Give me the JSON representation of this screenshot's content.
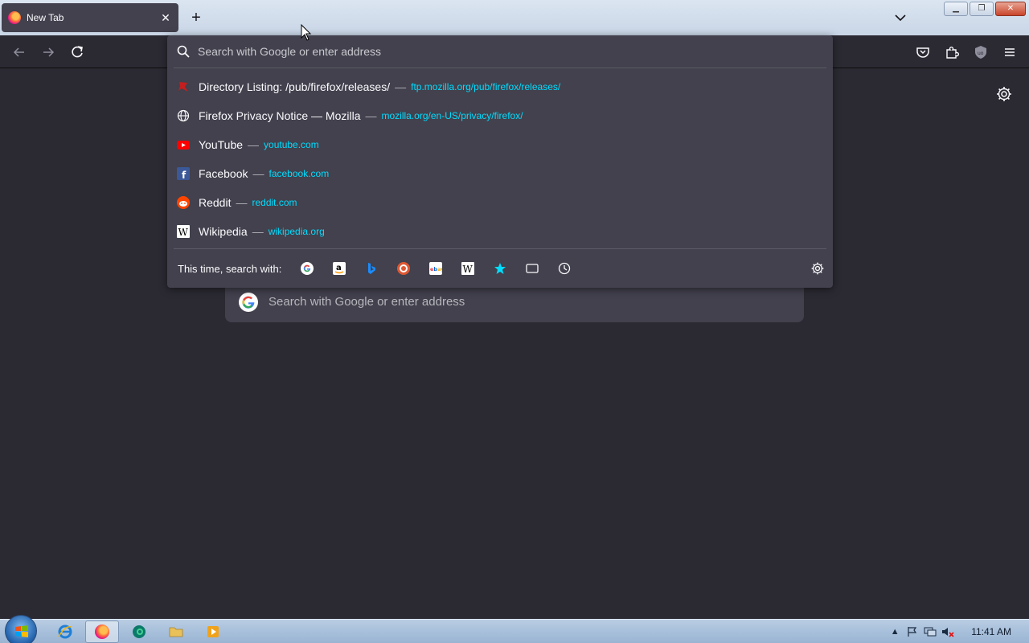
{
  "tab": {
    "title": "New Tab",
    "close": "✕"
  },
  "newtab": {
    "label": "+"
  },
  "urlbar": {
    "placeholder": "Search with Google or enter address",
    "results": [
      {
        "title": "Directory Listing: /pub/firefox/releases/",
        "url": "ftp.mozilla.org/pub/firefox/releases/",
        "icon": "ftp-bug-icon"
      },
      {
        "title": "Firefox Privacy Notice — Mozilla",
        "url": "mozilla.org/en-US/privacy/firefox/",
        "icon": "globe-icon"
      },
      {
        "title": "YouTube",
        "url": "youtube.com",
        "icon": "youtube-icon"
      },
      {
        "title": "Facebook",
        "url": "facebook.com",
        "icon": "facebook-icon"
      },
      {
        "title": "Reddit",
        "url": "reddit.com",
        "icon": "reddit-icon"
      },
      {
        "title": "Wikipedia",
        "url": "wikipedia.org",
        "icon": "wikipedia-icon"
      }
    ],
    "separator": "—",
    "oneoffs_label": "This time, search with:"
  },
  "content": {
    "search_placeholder": "Search with Google or enter address"
  },
  "taskbar": {
    "clock": "11:41 AM"
  },
  "colors": {
    "accent_url": "#00ddff",
    "panel": "#42414d",
    "page": "#2b2a33"
  }
}
